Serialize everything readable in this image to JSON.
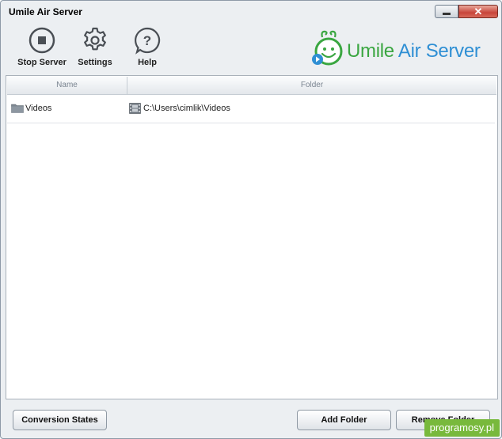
{
  "window": {
    "title": "Umile Air Server"
  },
  "toolbar": {
    "stop_label": "Stop Server",
    "settings_label": "Settings",
    "help_label": "Help"
  },
  "logo": {
    "part1": "Umile ",
    "part2": "Air Server"
  },
  "table": {
    "columns": [
      "Name",
      "Folder"
    ],
    "rows": [
      {
        "name": "Videos",
        "folder": "C:\\Users\\cimlik\\Videos"
      }
    ]
  },
  "footer": {
    "conversion_label": "Conversion States",
    "add_label": "Add Folder",
    "remove_label": "Remove Folder"
  },
  "watermark": "programosy.pl",
  "colors": {
    "accent_green": "#3aa641",
    "accent_blue": "#2f8fd4",
    "close_red": "#c8443a",
    "watermark_green": "#78b93c"
  }
}
